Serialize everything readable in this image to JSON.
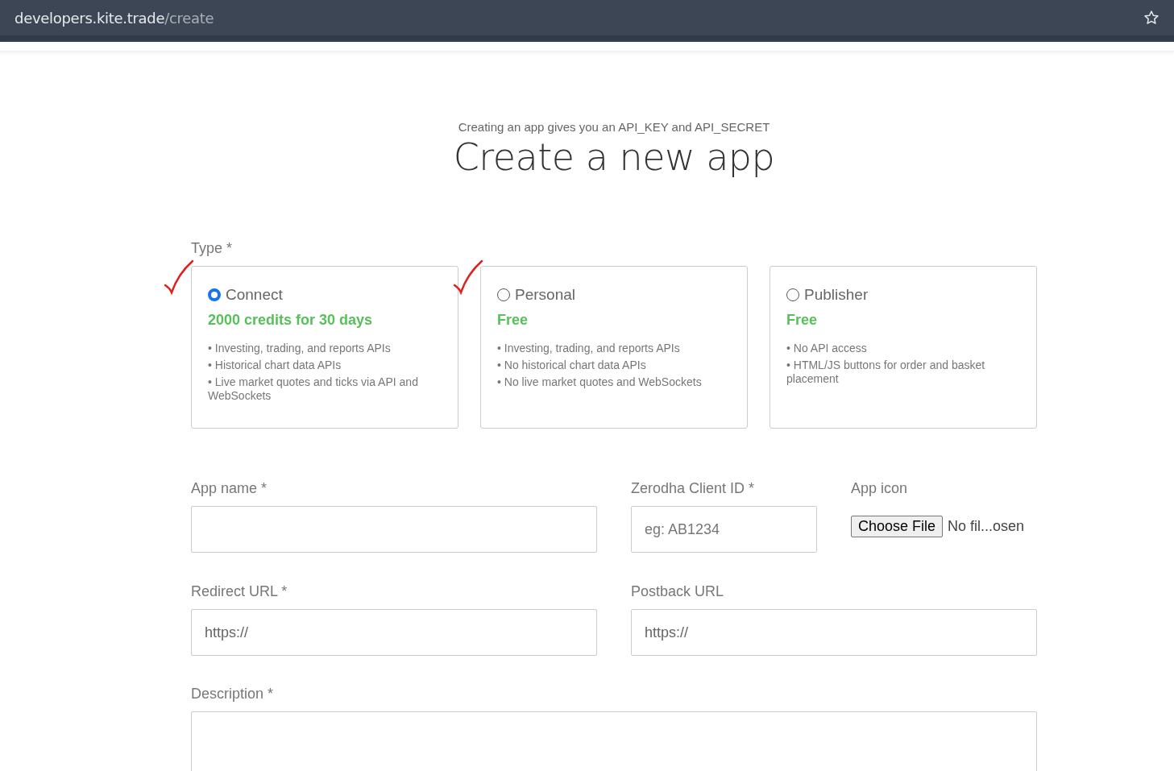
{
  "browser": {
    "url_host": "developers.kite.trade",
    "url_path": "/create"
  },
  "header": {
    "subtitle": "Creating an app gives you an API_KEY and API_SECRET",
    "title": "Create a new app"
  },
  "type_label": "Type *",
  "types": [
    {
      "name": "Connect",
      "price": "2000 credits for 30 days",
      "selected": true,
      "annotated": true,
      "features": [
        "• Investing, trading, and reports APIs",
        "• Historical chart data APIs",
        "• Live market quotes and ticks via API and WebSockets"
      ]
    },
    {
      "name": "Personal",
      "price": "Free",
      "selected": false,
      "annotated": true,
      "features": [
        "• Investing, trading, and reports APIs",
        "• No historical chart data APIs",
        "• No live market quotes and WebSockets"
      ]
    },
    {
      "name": "Publisher",
      "price": "Free",
      "selected": false,
      "annotated": false,
      "features": [
        "• No API access",
        "• HTML/JS buttons for order and basket placement"
      ]
    }
  ],
  "fields": [
    {
      "kind": "text",
      "label": "App name *"
    },
    {
      "kind": "text",
      "label": "Zerodha Client ID *",
      "placeholder": "eg: AB1234"
    },
    {
      "kind": "file",
      "label": "App icon",
      "button": "Choose File",
      "status": "No fil...osen"
    },
    {
      "kind": "text",
      "label": "Redirect URL *",
      "value": "https://"
    },
    {
      "kind": "text",
      "label": "Postback URL",
      "value": "https://"
    },
    {
      "kind": "textarea",
      "label": "Description *"
    }
  ]
}
